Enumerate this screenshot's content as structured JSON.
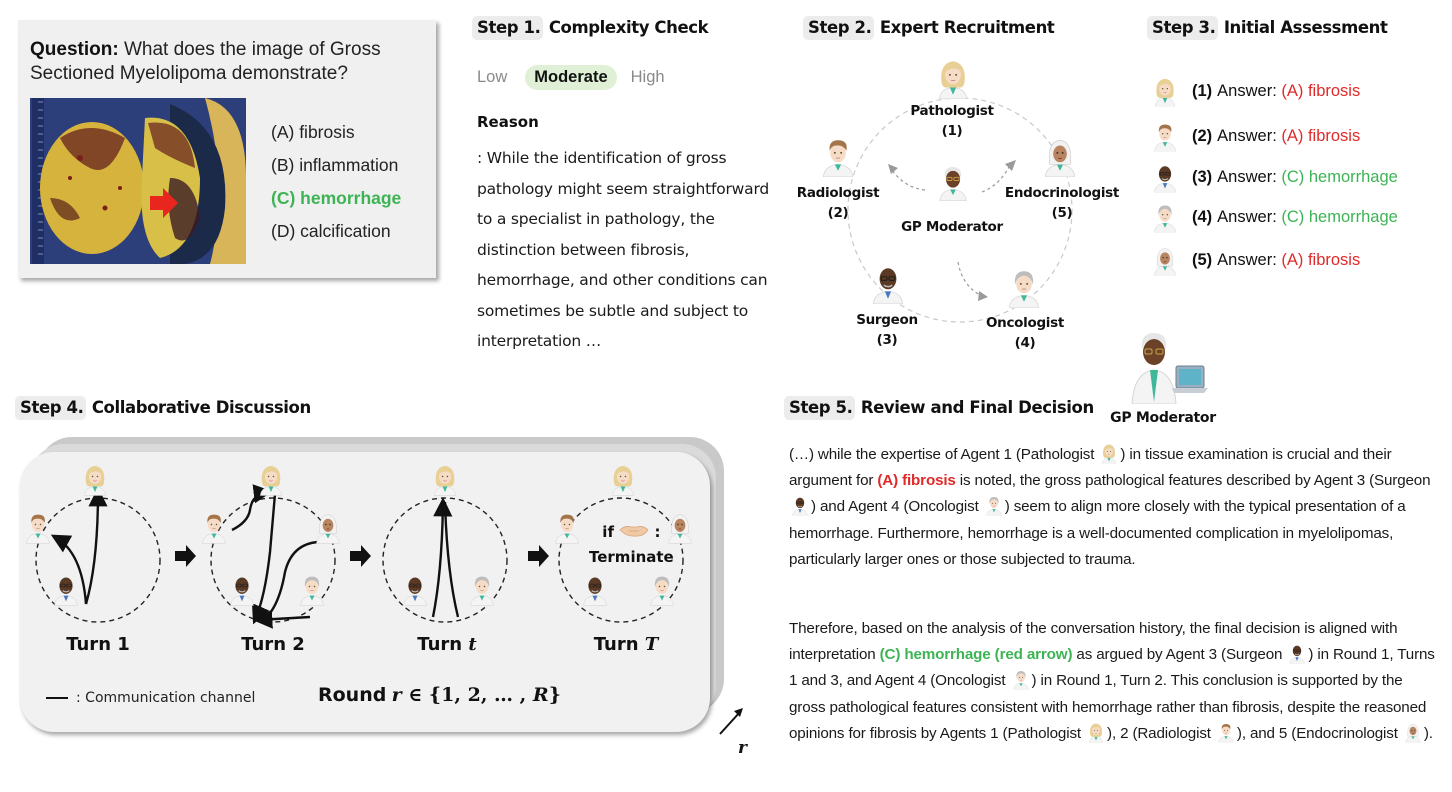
{
  "question": {
    "label": "Question:",
    "text": " What does the image of Gross Sectioned Myelolipoma demonstrate?",
    "image_alt": "gross-sectioned-myelolipoma-photo",
    "options": [
      {
        "text": "(A) fibrosis",
        "correct": false
      },
      {
        "text": "(B) inflammation",
        "correct": false
      },
      {
        "text": "(C) hemorrhage",
        "correct": true
      },
      {
        "text": "(D) calcification",
        "correct": false
      }
    ]
  },
  "step1": {
    "tag": "Step 1.",
    "title": " Complexity Check",
    "levels": [
      "Low",
      "Moderate",
      "High"
    ],
    "selected_level": "Moderate",
    "reason_title": "Reason",
    "reason_text": ": While the identification of gross pathology might seem straightforward to a specialist in pathology, the distinction between fibrosis, hemorrhage, and other conditions can sometimes be subtle and subject to interpretation …"
  },
  "step2": {
    "tag": "Step 2.",
    "title": " Expert Recruitment",
    "moderator": "GP Moderator",
    "experts": [
      {
        "name": "Pathologist",
        "num": "(1)"
      },
      {
        "name": "Radiologist",
        "num": "(2)"
      },
      {
        "name": "Surgeon",
        "num": "(3)"
      },
      {
        "name": "Oncologist",
        "num": "(4)"
      },
      {
        "name": "Endocrinologist",
        "num": "(5)"
      }
    ]
  },
  "step3": {
    "tag": "Step 3.",
    "title": " Initial Assessment",
    "answers": [
      {
        "num": "(1)",
        "label": "Answer:",
        "answer": "(A) fibrosis",
        "color": "#e02a2a"
      },
      {
        "num": "(2)",
        "label": "Answer:",
        "answer": "(A) fibrosis",
        "color": "#e02a2a"
      },
      {
        "num": "(3)",
        "label": "Answer:",
        "answer": "(C) hemorrhage",
        "color": "#3db454"
      },
      {
        "num": "(4)",
        "label": "Answer:",
        "answer": "(C) hemorrhage",
        "color": "#3db454"
      },
      {
        "num": "(5)",
        "label": "Answer:",
        "answer": "(A) fibrosis",
        "color": "#e02a2a"
      }
    ]
  },
  "step4": {
    "tag": "Step 4.",
    "title": " Collaborative Discussion",
    "turns": [
      {
        "label": "Turn ",
        "var": "1"
      },
      {
        "label": "Turn ",
        "var": "2"
      },
      {
        "label": "Turn ",
        "var": "t"
      },
      {
        "label": "Turn ",
        "var": "T"
      }
    ],
    "terminate_if": "if",
    "terminate_colon": ":",
    "terminate_label": "Terminate",
    "legend": ": Communication channel",
    "round_word": "Round",
    "round_var": "r",
    "round_set": " ∈ {1, 2, … , ",
    "round_max": "R",
    "round_close": "}",
    "stack_axis": "r"
  },
  "step5": {
    "tag": "Step 5.",
    "title": " Review and Final Decision",
    "moderator": "GP Moderator",
    "p1": {
      "a": "(…) while the expertise of Agent 1 (Pathologist ",
      "b": ") in tissue examination is crucial and their argument for ",
      "hl": "(A) fibrosis",
      "c": " is noted, the gross pathological features described by Agent 3 (Surgeon ",
      "d": ") and Agent 4 (Oncologist ",
      "e": ") seem to align more closely with the typical presentation of a hemorrhage. Furthermore, hemorrhage is a well-documented complication in myelolipomas, particularly larger ones or those subjected to trauma."
    },
    "p2": {
      "a": "Therefore, based on the analysis of the conversation history, the final decision is aligned with interpretation ",
      "hl": "(C) hemorrhage (red arrow)",
      "b": " as argued by Agent 3 (Surgeon ",
      "c": ") in Round 1, Turns 1 and 3, and Agent 4 (Oncologist ",
      "d": ") in Round 1, Turn 2. This conclusion is supported by the gross pathological features consistent with hemorrhage rather than fibrosis, despite the reasoned opinions for fibrosis by Agents 1 (Pathologist ",
      "e": "), 2 (Radiologist ",
      "f": "), and 5 (Endocrinologist ",
      "g": ")."
    }
  },
  "colors": {
    "correct": "#3db454",
    "incorrect": "#e02a2a",
    "moderate_pill": "#dff0d6",
    "panel_bg": "#f0f0f0"
  }
}
